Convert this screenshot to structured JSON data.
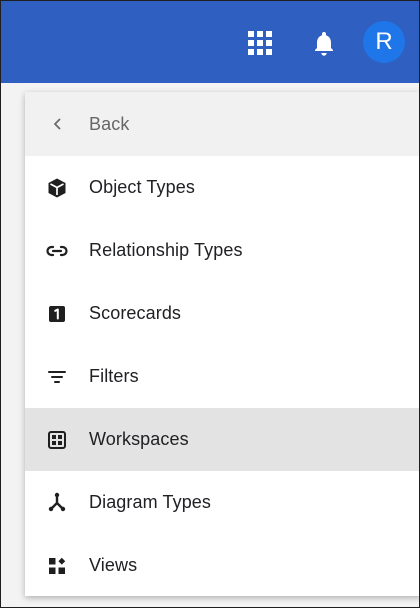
{
  "header": {
    "apps_icon": "grid-apps-icon",
    "notifications_icon": "bell-icon",
    "avatar_initial": "R",
    "bar_color": "#2f5fc1",
    "avatar_color": "#1e76e8"
  },
  "menu": {
    "back_label": "Back",
    "items": [
      {
        "label": "Object Types",
        "icon": "cube-icon"
      },
      {
        "label": "Relationship Types",
        "icon": "link-icon"
      },
      {
        "label": "Scorecards",
        "icon": "scorecard-icon"
      },
      {
        "label": "Filters",
        "icon": "filter-icon"
      },
      {
        "label": "Workspaces",
        "icon": "workspace-icon",
        "active": true
      },
      {
        "label": "Diagram Types",
        "icon": "hub-icon"
      },
      {
        "label": "Views",
        "icon": "views-icon"
      }
    ]
  }
}
